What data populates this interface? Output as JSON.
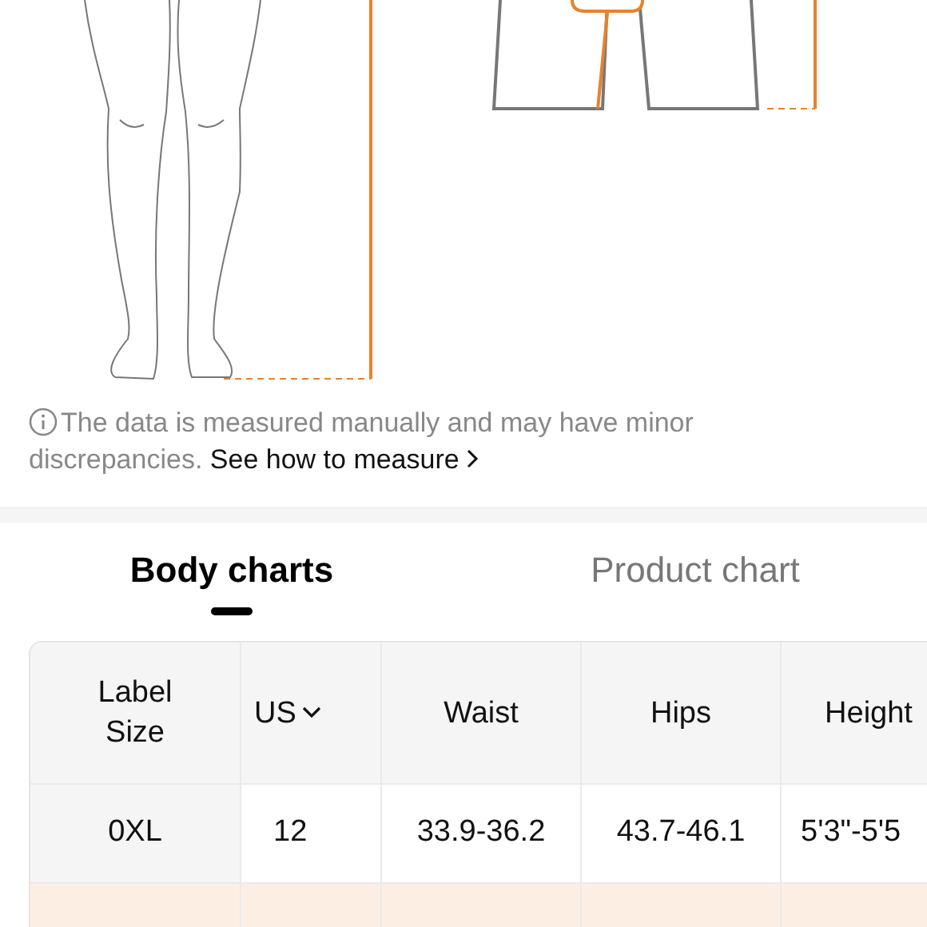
{
  "note": {
    "text": "The data is measured manually and may have minor discrepancies.",
    "link": "See how to measure"
  },
  "tabs": [
    {
      "label": "Body charts",
      "selected": true
    },
    {
      "label": "Product chart",
      "selected": false
    }
  ],
  "table": {
    "columns": [
      {
        "label": "Label Size"
      },
      {
        "label": "US",
        "dropdown": true
      },
      {
        "label": "Waist"
      },
      {
        "label": "Hips"
      },
      {
        "label": "Height"
      }
    ],
    "rows": [
      {
        "selected": false,
        "cells": [
          "0XL",
          "12",
          "33.9-36.2",
          "43.7-46.1",
          "5'3\"-5'5"
        ]
      },
      {
        "selected": true
      }
    ]
  }
}
